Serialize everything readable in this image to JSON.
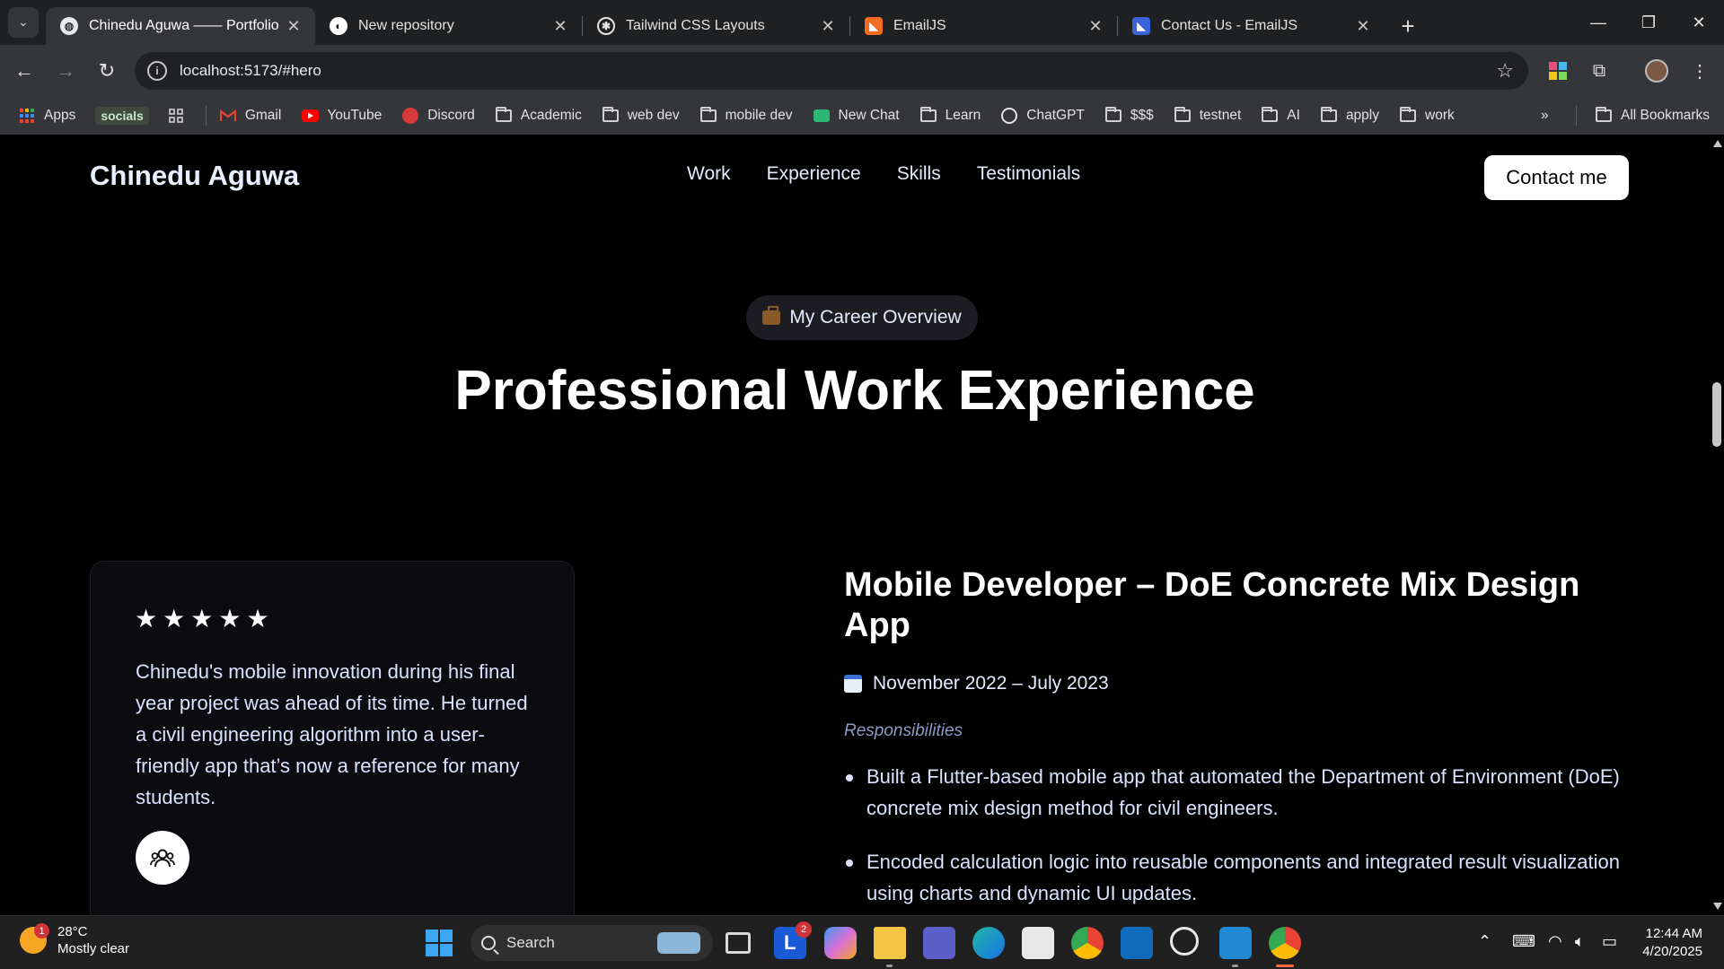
{
  "browser": {
    "tabs": [
      {
        "title": "Chinedu Aguwa —— Portfolio",
        "active": true
      },
      {
        "title": "New repository",
        "active": false
      },
      {
        "title": "Tailwind CSS Layouts",
        "active": false
      },
      {
        "title": "EmailJS",
        "active": false
      },
      {
        "title": "Contact Us - EmailJS",
        "active": false
      }
    ],
    "url": "localhost:5173/#hero",
    "bookmarks": [
      {
        "label": "Apps",
        "icon": "apps-grid-icon"
      },
      {
        "label": "socials",
        "icon": "socials-badge"
      },
      {
        "label": "Gmail",
        "icon": "gmail-icon"
      },
      {
        "label": "YouTube",
        "icon": "youtube-icon"
      },
      {
        "label": "Discord",
        "icon": "discord-icon"
      },
      {
        "label": "Academic",
        "icon": "folder-icon"
      },
      {
        "label": "web dev",
        "icon": "folder-icon"
      },
      {
        "label": "mobile dev",
        "icon": "folder-icon"
      },
      {
        "label": "New Chat",
        "icon": "bot-icon"
      },
      {
        "label": "Learn",
        "icon": "folder-icon"
      },
      {
        "label": "ChatGPT",
        "icon": "chatgpt-icon"
      },
      {
        "label": "$$$",
        "icon": "folder-icon"
      },
      {
        "label": "testnet",
        "icon": "folder-icon"
      },
      {
        "label": "AI",
        "icon": "folder-icon"
      },
      {
        "label": "apply",
        "icon": "folder-icon"
      },
      {
        "label": "work",
        "icon": "folder-icon"
      }
    ],
    "all_bookmarks": "All Bookmarks"
  },
  "site": {
    "brand": "Chinedu Aguwa",
    "nav": [
      "Work",
      "Experience",
      "Skills",
      "Testimonials"
    ],
    "contact": "Contact me",
    "badge": "My Career Overview",
    "headline": "Professional Work Experience",
    "testimonial": {
      "rating": 5,
      "stars": "★★★★★",
      "quote": "Chinedu's mobile innovation during his final year project was ahead of its time. He turned a civil engineering algorithm into a user-friendly app that’s now a reference for many students."
    },
    "job": {
      "title": "Mobile Developer – DoE Concrete Mix Design App",
      "date": "November 2022 – July 2023",
      "responsibilities_label": "Responsibilities",
      "responsibilities": [
        "Built a Flutter-based mobile app that automated the Department of Environment (DoE) concrete mix design method for civil engineers.",
        "Encoded calculation logic into reusable components and integrated result visualization using charts and dynamic UI updates."
      ]
    }
  },
  "taskbar": {
    "weather_temp": "28°C",
    "weather_desc": "Mostly clear",
    "weather_badge": "1",
    "search_label": "Search",
    "launcher_badge": "2",
    "time": "12:44 AM",
    "date": "4/20/2025"
  },
  "colors": {
    "accent_tab": "#35363a",
    "page_bg": "#000000",
    "card_bg": "#0c0c10",
    "text_soft": "#d9e2ff",
    "label_muted": "#8a9bc4"
  }
}
